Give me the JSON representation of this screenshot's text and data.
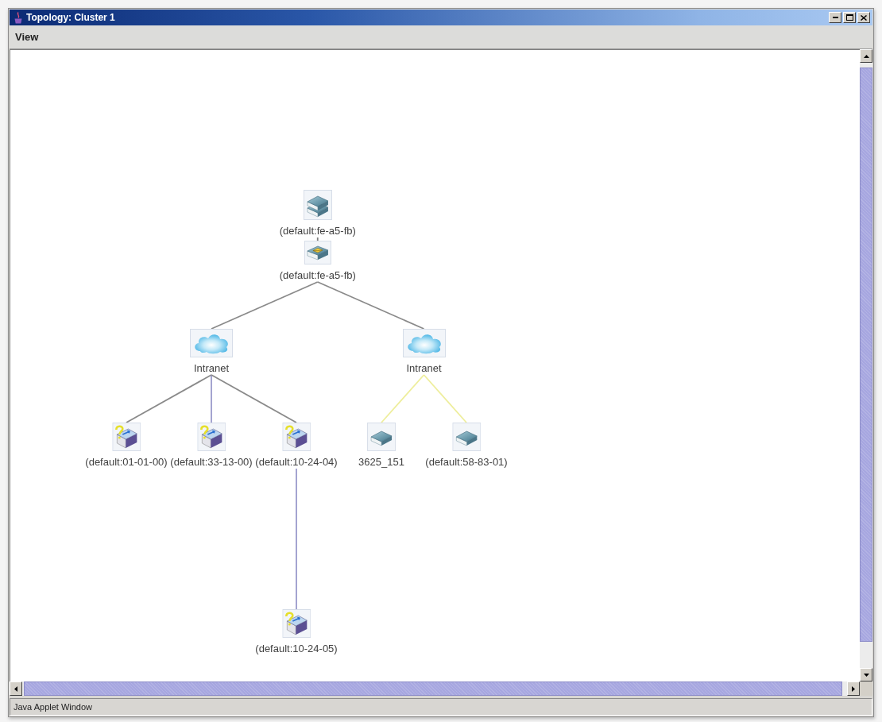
{
  "window": {
    "title": "Topology: Cluster 1"
  },
  "menu_bar": [
    "View"
  ],
  "topology": {
    "root": {
      "label": "(default:fe-a5-fb)",
      "kind": "stack",
      "children": [
        {
          "label": "(default:fe-a5-fb)",
          "kind": "router",
          "link": {
            "color": "#808080"
          },
          "children": [
            {
              "label": "Intranet",
              "kind": "cloud",
              "link": {
                "color": "#8a8a8a"
              },
              "children": [
                {
                  "label": "(default:01-01-00)",
                  "kind": "unknown",
                  "link": {
                    "color": "#8a8a8a"
                  }
                },
                {
                  "label": "(default:33-13-00)",
                  "kind": "unknown",
                  "link": {
                    "color": "#9a9acb"
                  }
                },
                {
                  "label": "(default:10-24-04)",
                  "kind": "unknown",
                  "link": {
                    "color": "#8a8a8a"
                  },
                  "children": [
                    {
                      "label": "(default:10-24-05)",
                      "kind": "unknown",
                      "link": {
                        "color": "#9a9acb"
                      }
                    }
                  ]
                }
              ]
            },
            {
              "label": "Intranet",
              "kind": "cloud",
              "link": {
                "color": "#8a8a8a"
              },
              "children": [
                {
                  "label": "3625_151",
                  "kind": "switch",
                  "link": {
                    "color": "#eeee9c"
                  }
                },
                {
                  "label": "(default:58-83-01)",
                  "kind": "switch",
                  "link": {
                    "color": "#eeee9c"
                  }
                }
              ]
            }
          ]
        }
      ]
    }
  },
  "status_bar": {
    "text": "Java Applet Window"
  }
}
